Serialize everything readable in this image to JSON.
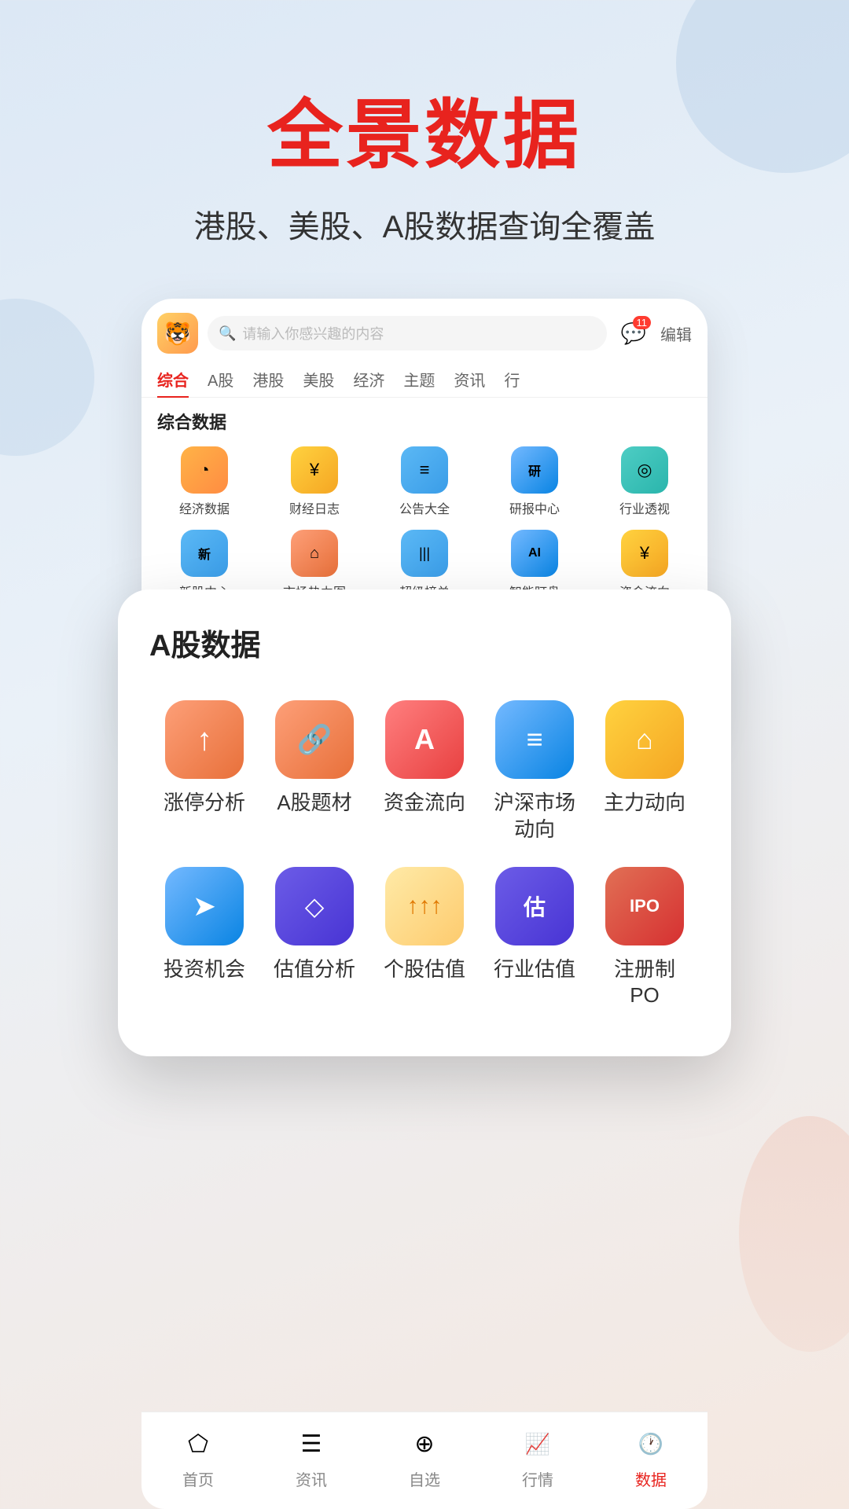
{
  "header": {
    "main_title": "全景数据",
    "sub_title": "港股、美股、A股数据查询全覆盖"
  },
  "phone_mockup": {
    "search_placeholder": "请输入你感兴趣的内容",
    "msg_badge": "11",
    "edit_label": "编辑",
    "tabs": [
      {
        "label": "综合",
        "active": true
      },
      {
        "label": "A股",
        "active": false
      },
      {
        "label": "港股",
        "active": false
      },
      {
        "label": "美股",
        "active": false
      },
      {
        "label": "经济",
        "active": false
      },
      {
        "label": "主题",
        "active": false
      },
      {
        "label": "资讯",
        "active": false
      },
      {
        "label": "行",
        "active": false
      }
    ],
    "section1_title": "综合数据",
    "icons_row1": [
      {
        "label": "经济数据",
        "color": "c-orange",
        "symbol": "◔"
      },
      {
        "label": "财经日志",
        "color": "c-gold",
        "symbol": "¥"
      },
      {
        "label": "公告大全",
        "color": "c-blue",
        "symbol": "≡"
      },
      {
        "label": "研报中心",
        "color": "c-blue",
        "symbol": "研"
      },
      {
        "label": "行业透视",
        "color": "c-teal",
        "symbol": "◎"
      }
    ],
    "icons_row2": [
      {
        "label": "新股中心",
        "color": "c-blue",
        "symbol": "新"
      },
      {
        "label": "市场热力图",
        "color": "c-salmon",
        "symbol": "⌂"
      },
      {
        "label": "超级榜单",
        "color": "c-blue",
        "symbol": "|||"
      },
      {
        "label": "智能盯盘",
        "color": "c-blue",
        "symbol": "AI"
      },
      {
        "label": "资金流向",
        "color": "c-gold",
        "symbol": "¥"
      }
    ]
  },
  "popup_card": {
    "title": "A股数据",
    "items_row1": [
      {
        "label": "涨停分析",
        "color": "c-salmon",
        "symbol": "↑"
      },
      {
        "label": "A股题材",
        "color": "c-salmon",
        "symbol": "🔗"
      },
      {
        "label": "资金流向",
        "color": "c-coral",
        "symbol": "A"
      },
      {
        "label": "沪深市场\n动向",
        "color": "c-sky",
        "symbol": "≡"
      },
      {
        "label": "主力动向",
        "color": "c-gold",
        "symbol": "⌂"
      }
    ],
    "items_row2": [
      {
        "label": "投资机会",
        "color": "c-sky",
        "symbol": "➤"
      },
      {
        "label": "估值分析",
        "color": "c-indigo",
        "symbol": "◇"
      },
      {
        "label": "个股估值",
        "color": "c-amber",
        "symbol": "↑↑"
      },
      {
        "label": "行业估值",
        "color": "c-indigo",
        "symbol": "估"
      },
      {
        "label": "注册制\nPO",
        "color": "c-rose",
        "symbol": "IPO"
      }
    ]
  },
  "bg_section": {
    "row1": [
      {
        "label": "涨停分析",
        "color": "c-salmon",
        "symbol": "↑"
      },
      {
        "label": "A股题材",
        "color": "c-salmon",
        "symbol": "🔗"
      },
      {
        "label": "资金流向",
        "color": "c-coral",
        "symbol": "A"
      },
      {
        "label": "沪深市场\n动向",
        "color": "c-sky",
        "symbol": "≡"
      },
      {
        "label": "主力动向",
        "color": "c-gold",
        "symbol": "⌂"
      }
    ]
  },
  "bottom_nav": {
    "items": [
      {
        "label": "首页",
        "active": false,
        "symbol": "⬠"
      },
      {
        "label": "资讯",
        "active": false,
        "symbol": "☰"
      },
      {
        "label": "自选",
        "active": false,
        "symbol": "⊕"
      },
      {
        "label": "行情",
        "active": false,
        "symbol": "📈"
      },
      {
        "label": "数据",
        "active": true,
        "symbol": "🕐"
      }
    ]
  }
}
